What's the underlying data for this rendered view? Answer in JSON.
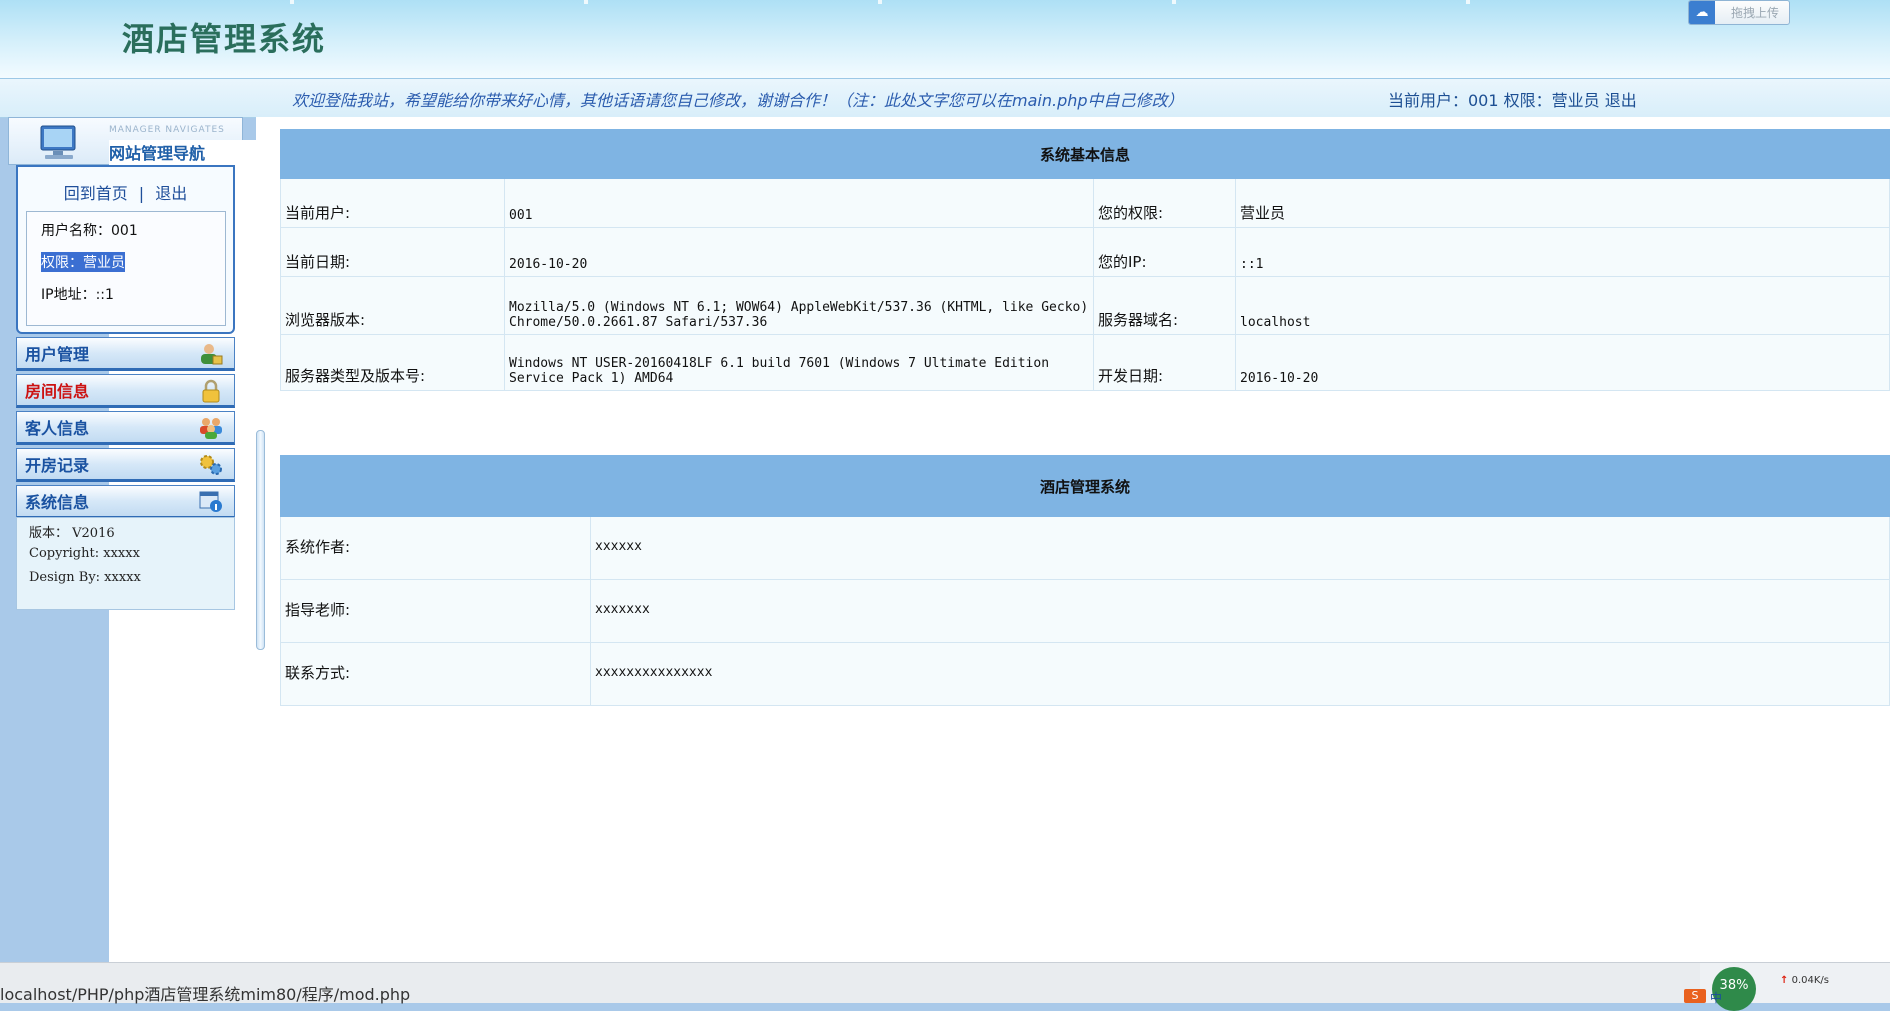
{
  "header": {
    "title": "酒店管理系统",
    "upload_label": "拖拽上传",
    "welcome_text": "欢迎登陆我站，希望能给你带来好心情，其他话语请您自己修改，谢谢合作！（注：此处文字您可以在main.php中自己修改）",
    "current_user_text": "当前用户：001 权限：营业员",
    "logout_label": "退出"
  },
  "sidebar": {
    "nav_sub": "MANAGER NAVIGATES",
    "nav_title": "网站管理导航",
    "home_link": "回到首页",
    "separator": "|",
    "logout_link": "退出",
    "username_text": "用户名称：001",
    "role_text": "权限：营业员",
    "ip_text": "IP地址：::1",
    "menu": [
      {
        "label": "用户管理",
        "icon": "user-lock-icon"
      },
      {
        "label": "房间信息",
        "icon": "padlock-icon"
      },
      {
        "label": "客人信息",
        "icon": "people-icon"
      },
      {
        "label": "开房记录",
        "icon": "gears-icon"
      },
      {
        "label": "系统信息",
        "icon": "info-window-icon"
      }
    ],
    "version": "版本： V2016",
    "copyright": "Copyright: xxxxx",
    "design": "Design By:  xxxxx"
  },
  "system_info": {
    "caption": "系统基本信息",
    "current_user_label": "当前用户:",
    "current_user_value": "001",
    "role_label": "您的权限:",
    "role_value": "营业员",
    "date_label": "当前日期:",
    "date_value": "2016-10-20",
    "ip_label": "您的IP:",
    "ip_value": "::1",
    "browser_label": "浏览器版本:",
    "browser_value": "Mozilla/5.0 (Windows NT 6.1; WOW64) AppleWebKit/537.36 (KHTML, like Gecko) Chrome/50.0.2661.87 Safari/537.36",
    "domain_label": "服务器域名:",
    "domain_value": "localhost",
    "server_label": "服务器类型及版本号:",
    "server_value": "Windows NT USER-20160418LF 6.1 build 7601 (Windows 7 Ultimate Edition Service Pack 1) AMD64",
    "devdate_label": "开发日期:",
    "devdate_value": "2016-10-20"
  },
  "hotel_info": {
    "caption": "酒店管理系统",
    "author_label": "系统作者:",
    "author_value": "xxxxxx",
    "teacher_label": "指导老师:",
    "teacher_value": "xxxxxxx",
    "contact_label": "联系方式:",
    "contact_value": "xxxxxxxxxxxxxxx"
  },
  "statusbar": {
    "url": "localhost/PHP/php酒店管理系统mim80/程序/mod.php",
    "cpu": "38%",
    "net_speed": "0.04K/s",
    "ime": "中"
  },
  "colors": {
    "accent": "#2b5cae",
    "active_menu": "#cc1212",
    "table_caption": "#7fb4e3"
  }
}
